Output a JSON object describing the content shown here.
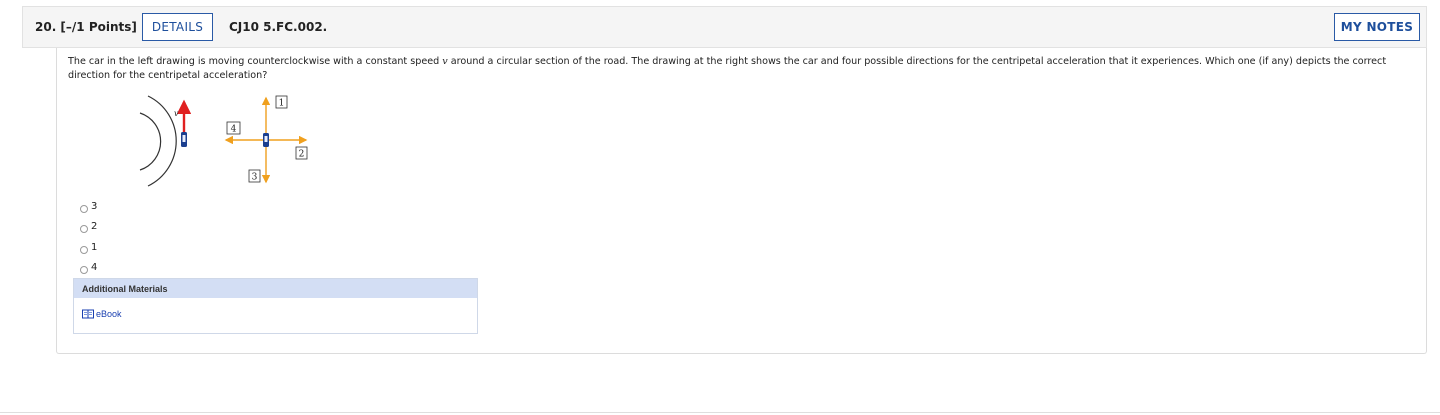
{
  "question": {
    "number_points": "20.  [–/1 Points]",
    "details_label": "DETAILS",
    "id": "CJ10 5.FC.002.",
    "my_notes_label": "MY NOTES",
    "text_before_var": "The car in the left drawing is moving counterclockwise with a constant speed ",
    "variable": "v",
    "text_after_var": " around a circular section of the road. The drawing at the right shows the car and four possible directions for the centripetal acceleration that it experiences. Which one (if any) depicts the correct direction for the centripetal acceleration?"
  },
  "figure": {
    "velocity_label": "v",
    "direction_labels": {
      "up": "1",
      "right": "2",
      "down": "3",
      "left": "4"
    },
    "colors": {
      "arrow_orange": "#f0a01e",
      "velocity_red": "#e02020",
      "car_blue": "#1b3f8f",
      "road": "#333333"
    }
  },
  "choices": [
    "3",
    "2",
    "1",
    "4"
  ],
  "additional_materials": {
    "title": "Additional Materials",
    "ebook_label": "eBook",
    "ebook_icon": "book-icon"
  }
}
